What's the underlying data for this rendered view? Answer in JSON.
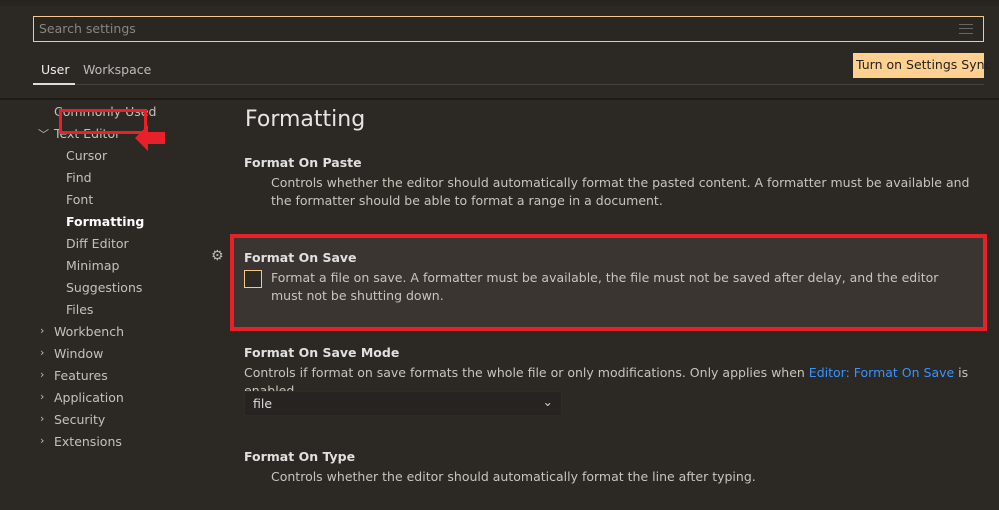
{
  "search": {
    "placeholder": "Search settings"
  },
  "tabs": [
    {
      "label": "User"
    },
    {
      "label": "Workspace"
    }
  ],
  "sync_button": "Turn on Settings Sync",
  "nav": {
    "commonly_used": "Commonly Used",
    "text_editor": "Text Editor",
    "children": [
      "Cursor",
      "Find",
      "Font",
      "Formatting",
      "Diff Editor",
      "Minimap",
      "Suggestions",
      "Files"
    ],
    "sections": [
      "Workbench",
      "Window",
      "Features",
      "Application",
      "Security",
      "Extensions"
    ]
  },
  "main": {
    "title": "Formatting",
    "paste": {
      "title": "Format On Paste",
      "desc": "Controls whether the editor should automatically format the pasted content. A formatter must be available and the formatter should be able to format a range in a document."
    },
    "save": {
      "title": "Format On Save",
      "desc": "Format a file on save. A formatter must be available, the file must not be saved after delay, and the editor must not be shutting down.",
      "checked": false
    },
    "save_mode": {
      "title": "Format On Save Mode",
      "desc_before": "Controls if format on save formats the whole file or only modifications. Only applies when ",
      "link": "Editor: Format On Save",
      "desc_after": " is enabled.",
      "value": "file"
    },
    "type": {
      "title": "Format On Type",
      "desc": "Controls whether the editor should automatically format the line after typing."
    }
  },
  "colors": {
    "accent": "#ffd08f",
    "highlight": "#e8202a",
    "link": "#3794ff"
  }
}
